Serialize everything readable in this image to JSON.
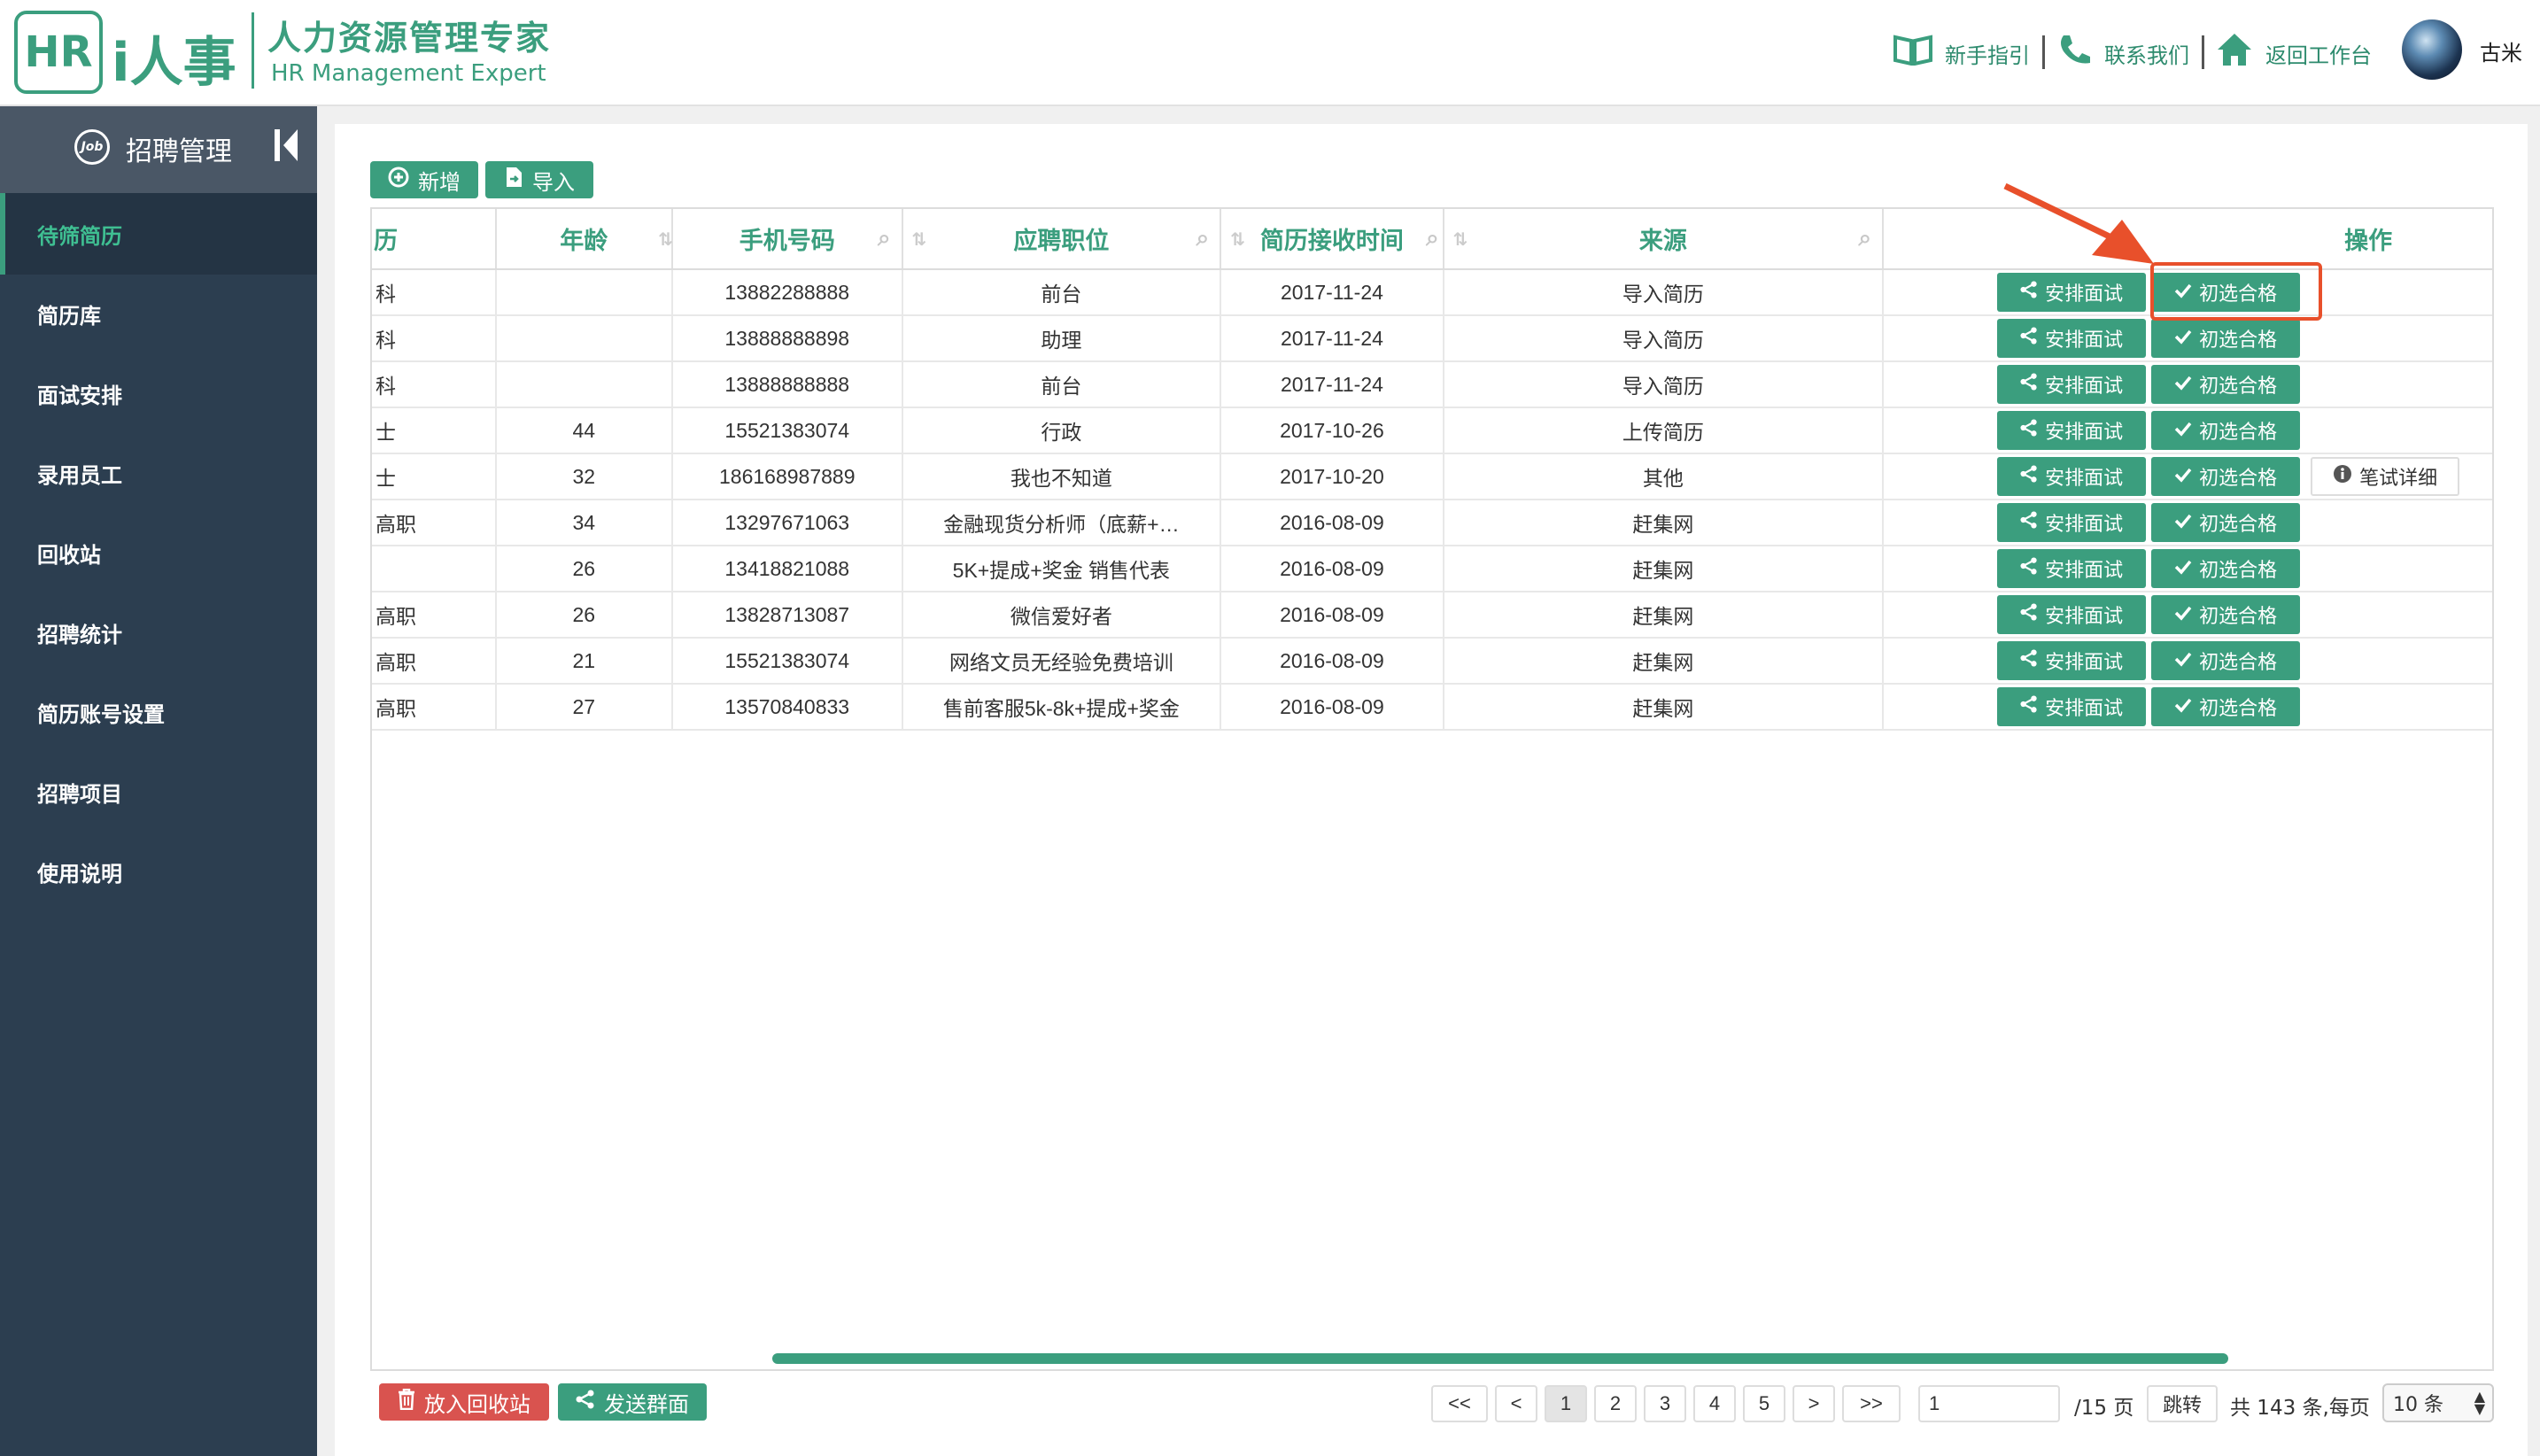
{
  "logo": {
    "mark": "HR",
    "brand": "i人事",
    "title_cn": "人力资源管理专家",
    "title_en": "HR Management Expert"
  },
  "topnav": {
    "guide": "新手指引",
    "contact": "联系我们",
    "back": "返回工作台",
    "user": "古米"
  },
  "sidebar": {
    "title": "招聘管理",
    "items": [
      {
        "label": "待筛简历",
        "active": true
      },
      {
        "label": "简历库"
      },
      {
        "label": "面试安排"
      },
      {
        "label": "录用员工"
      },
      {
        "label": "回收站"
      },
      {
        "label": "招聘统计"
      },
      {
        "label": "简历账号设置"
      },
      {
        "label": "招聘项目"
      },
      {
        "label": "使用说明"
      }
    ]
  },
  "toolbar": {
    "add": "新增",
    "import": "导入"
  },
  "table": {
    "headers": {
      "edu": "历",
      "age": "年龄",
      "phone": "手机号码",
      "position": "应聘职位",
      "received": "简历接收时间",
      "source": "来源",
      "ops": "操作"
    },
    "rows": [
      {
        "edu": "科",
        "age": "",
        "phone": "13882288888",
        "position": "前台",
        "received": "2017-11-24",
        "source": "导入简历"
      },
      {
        "edu": "科",
        "age": "",
        "phone": "13888888898",
        "position": "助理",
        "received": "2017-11-24",
        "source": "导入简历"
      },
      {
        "edu": "科",
        "age": "",
        "phone": "13888888888",
        "position": "前台",
        "received": "2017-11-24",
        "source": "导入简历"
      },
      {
        "edu": "士",
        "age": "44",
        "phone": "15521383074",
        "position": "行政",
        "received": "2017-10-26",
        "source": "上传简历"
      },
      {
        "edu": "士",
        "age": "32",
        "phone": "186168987889",
        "position": "我也不知道",
        "received": "2017-10-20",
        "source": "其他"
      },
      {
        "edu": "高职",
        "age": "34",
        "phone": "13297671063",
        "position": "金融现货分析师（底薪+…",
        "received": "2016-08-09",
        "source": "赶集网"
      },
      {
        "edu": "",
        "age": "26",
        "phone": "13418821088",
        "position": "5K+提成+奖金 销售代表",
        "received": "2016-08-09",
        "source": "赶集网"
      },
      {
        "edu": "高职",
        "age": "26",
        "phone": "13828713087",
        "position": "微信爱好者",
        "received": "2016-08-09",
        "source": "赶集网"
      },
      {
        "edu": "高职",
        "age": "21",
        "phone": "15521383074",
        "position": "网络文员无经验免费培训",
        "received": "2016-08-09",
        "source": "赶集网"
      },
      {
        "edu": "高职",
        "age": "27",
        "phone": "13570840833",
        "position": "售前客服5k-8k+提成+奖金",
        "received": "2016-08-09",
        "source": "赶集网"
      }
    ],
    "op_schedule": "安排面试",
    "op_pass": "初选合格",
    "op_detail": "笔试详细"
  },
  "footer": {
    "recycle": "放入回收站",
    "group_interview": "发送群面",
    "pages": {
      "first": "<<",
      "prev": "<",
      "p1": "1",
      "p2": "2",
      "p3": "3",
      "p4": "4",
      "p5": "5",
      "next": ">",
      "last": ">>"
    },
    "jump_value": "1",
    "total_pages": "/15 页",
    "jump": "跳转",
    "summary": "共 143 条,每页",
    "page_size": "10 条"
  },
  "colors": {
    "accent": "#3b9e7e",
    "sidebar": "#2c3e50",
    "danger": "#d9534f",
    "highlight": "#e8502b"
  }
}
